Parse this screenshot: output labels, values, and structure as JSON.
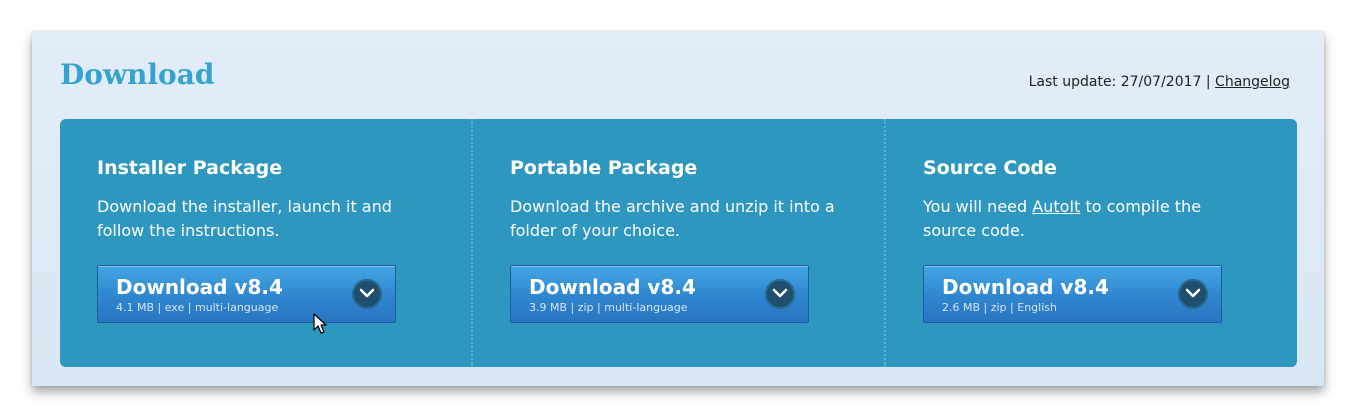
{
  "header": {
    "title": "Download",
    "last_update_label": "Last update: 27/07/2017 |",
    "changelog_link": "Changelog"
  },
  "packages": [
    {
      "title": "Installer Package",
      "description": "Download the installer, launch it and follow the instructions.",
      "button_label": "Download v8.4",
      "button_details": "4.1 MB | exe | multi-language"
    },
    {
      "title": "Portable Package",
      "description": "Download the archive and unzip it into a folder of your choice.",
      "button_label": "Download v8.4",
      "button_details": "3.9 MB | zip | multi-language"
    },
    {
      "title": "Source Code",
      "description_before": "You will need",
      "description_link": "AutoIt",
      "description_after": "to compile the source code.",
      "button_label": "Download v8.4",
      "button_details": "2.6 MB | zip | English"
    }
  ],
  "icons": {
    "chevron": "chevron-down-icon",
    "cursor": "mouse-pointer-icon"
  },
  "colors": {
    "title": "#35a3d0",
    "panel": "#2e97bf",
    "button": "#2f86cf",
    "chevron_bg": "#1f4f6f"
  }
}
